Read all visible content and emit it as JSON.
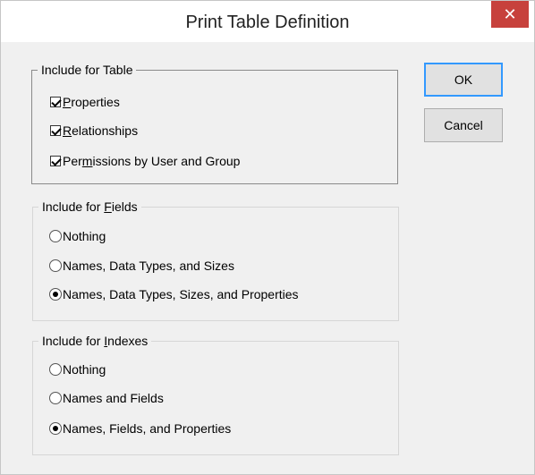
{
  "window": {
    "title": "Print Table Definition",
    "close_glyph": "✕"
  },
  "buttons": {
    "ok": "OK",
    "cancel": "Cancel"
  },
  "table_group": {
    "label": "Include for Table",
    "options": [
      {
        "label_pre": "",
        "label_u": "P",
        "label_post": "roperties",
        "checked": true
      },
      {
        "label_pre": "",
        "label_u": "R",
        "label_post": "elationships",
        "checked": true
      },
      {
        "label_pre": "Per",
        "label_u": "m",
        "label_post": "issions by User and Group",
        "checked": true
      }
    ]
  },
  "fields_group": {
    "label_pre": "Include for ",
    "label_u": "F",
    "label_post": "ields",
    "options": [
      {
        "label": "Nothing",
        "selected": false
      },
      {
        "label": "Names, Data Types, and Sizes",
        "selected": false
      },
      {
        "label": "Names, Data Types, Sizes, and Properties",
        "selected": true
      }
    ]
  },
  "indexes_group": {
    "label_pre": "Include for ",
    "label_u": "I",
    "label_post": "ndexes",
    "options": [
      {
        "label": "Nothing",
        "selected": false
      },
      {
        "label": "Names and Fields",
        "selected": false
      },
      {
        "label": "Names, Fields, and Properties",
        "selected": true
      }
    ]
  }
}
